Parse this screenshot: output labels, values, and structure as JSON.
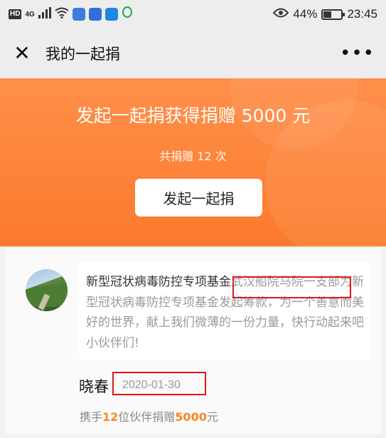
{
  "status_bar": {
    "network_badge": "HD",
    "network_type": "4G",
    "battery_percent": "44%",
    "battery_level": 0.44,
    "time": "23:45",
    "icons": [
      "signal-icon",
      "wifi-icon",
      "eye-icon",
      "battery-icon"
    ]
  },
  "title_bar": {
    "close_glyph": "✕",
    "title": "我的一起捐",
    "more_glyph": "•••"
  },
  "hero": {
    "headline": "发起一起捐获得捐赠 5000 元",
    "donation_count": "共捐赠 12 次",
    "button_label": "发起一起捐"
  },
  "card": {
    "message_part1": "新型冠状病毒防控专项基金",
    "message_highlight": "武汉船院马院一支部",
    "message_part2": "为新型冠状病毒防控专项基金发起筹款，为一个善意而美好的世界，献上我们微薄的一份力量，快行动起来吧小伙伴们!",
    "donor_name": "晓春",
    "date": "2020-01-30",
    "partner_prefix": "携手",
    "partner_count": "12",
    "partner_middle": "位伙伴捐赠",
    "amount": "5000",
    "amount_suffix": "元"
  },
  "colors": {
    "accent_orange": "#fb7a2c",
    "highlight_red": "#e0161e",
    "number_orange": "#f58a1f"
  }
}
